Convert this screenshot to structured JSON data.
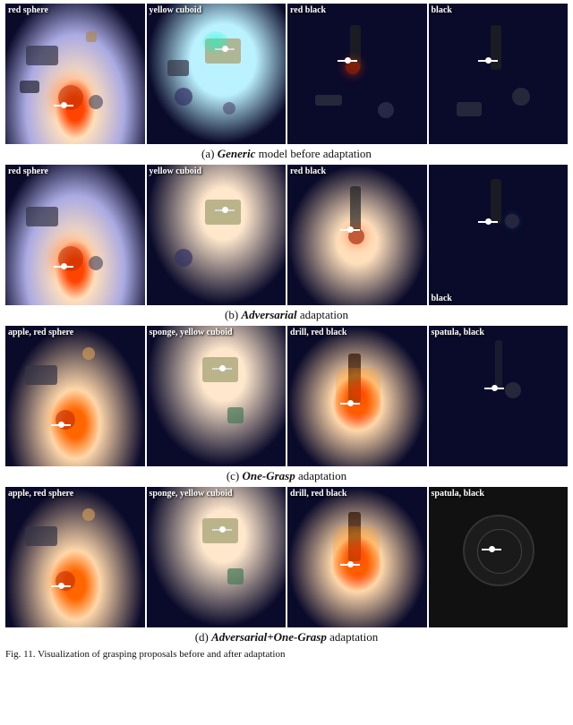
{
  "sections": [
    {
      "id": "section-a",
      "caption_prefix": "(a)",
      "caption_style": "italic",
      "caption_word": "Generic",
      "caption_suffix": " model before adaptation",
      "cells": [
        {
          "id": "r1c1",
          "label": "red sphere",
          "label_pos": "top"
        },
        {
          "id": "r1c2",
          "label": "yellow cuboid",
          "label_pos": "top"
        },
        {
          "id": "r1c3",
          "label": "red black",
          "label_pos": "top"
        },
        {
          "id": "r1c4",
          "label": "black",
          "label_pos": "top"
        }
      ]
    },
    {
      "id": "section-b",
      "caption_prefix": "(b)",
      "caption_style": "italic",
      "caption_word": "Adversarial",
      "caption_suffix": " adaptation",
      "cells": [
        {
          "id": "r2c1",
          "label": "red sphere",
          "label_pos": "top"
        },
        {
          "id": "r2c2",
          "label": "yellow cuboid",
          "label_pos": "top"
        },
        {
          "id": "r2c3",
          "label": "red black",
          "label_pos": "top"
        },
        {
          "id": "r2c4",
          "label": "black",
          "label_pos": "bottom"
        }
      ]
    },
    {
      "id": "section-c",
      "caption_prefix": "(c)",
      "caption_style": "italic",
      "caption_word": "One-Grasp",
      "caption_suffix": " adaptation",
      "cells": [
        {
          "id": "r3c1",
          "label": "apple, red sphere",
          "label_pos": "top"
        },
        {
          "id": "r3c2",
          "label": "sponge, yellow cuboid",
          "label_pos": "top"
        },
        {
          "id": "r3c3",
          "label": "drill, red black",
          "label_pos": "top"
        },
        {
          "id": "r3c4",
          "label": "spatula, black",
          "label_pos": "top"
        }
      ]
    },
    {
      "id": "section-d",
      "caption_prefix": "(d)",
      "caption_style": "italic",
      "caption_word": "Adversarial+One-Grasp",
      "caption_suffix": " adaptation",
      "cells": [
        {
          "id": "r4c1",
          "label": "apple, red sphere",
          "label_pos": "top"
        },
        {
          "id": "r4c2",
          "label": "sponge, yellow cuboid",
          "label_pos": "top"
        },
        {
          "id": "r4c3",
          "label": "drill, red black",
          "label_pos": "top"
        },
        {
          "id": "r4c4",
          "label": "spatula, black",
          "label_pos": "top"
        }
      ]
    }
  ],
  "fig_caption": "Fig. 11. Visualization of grasping proposals before and after adaptation"
}
